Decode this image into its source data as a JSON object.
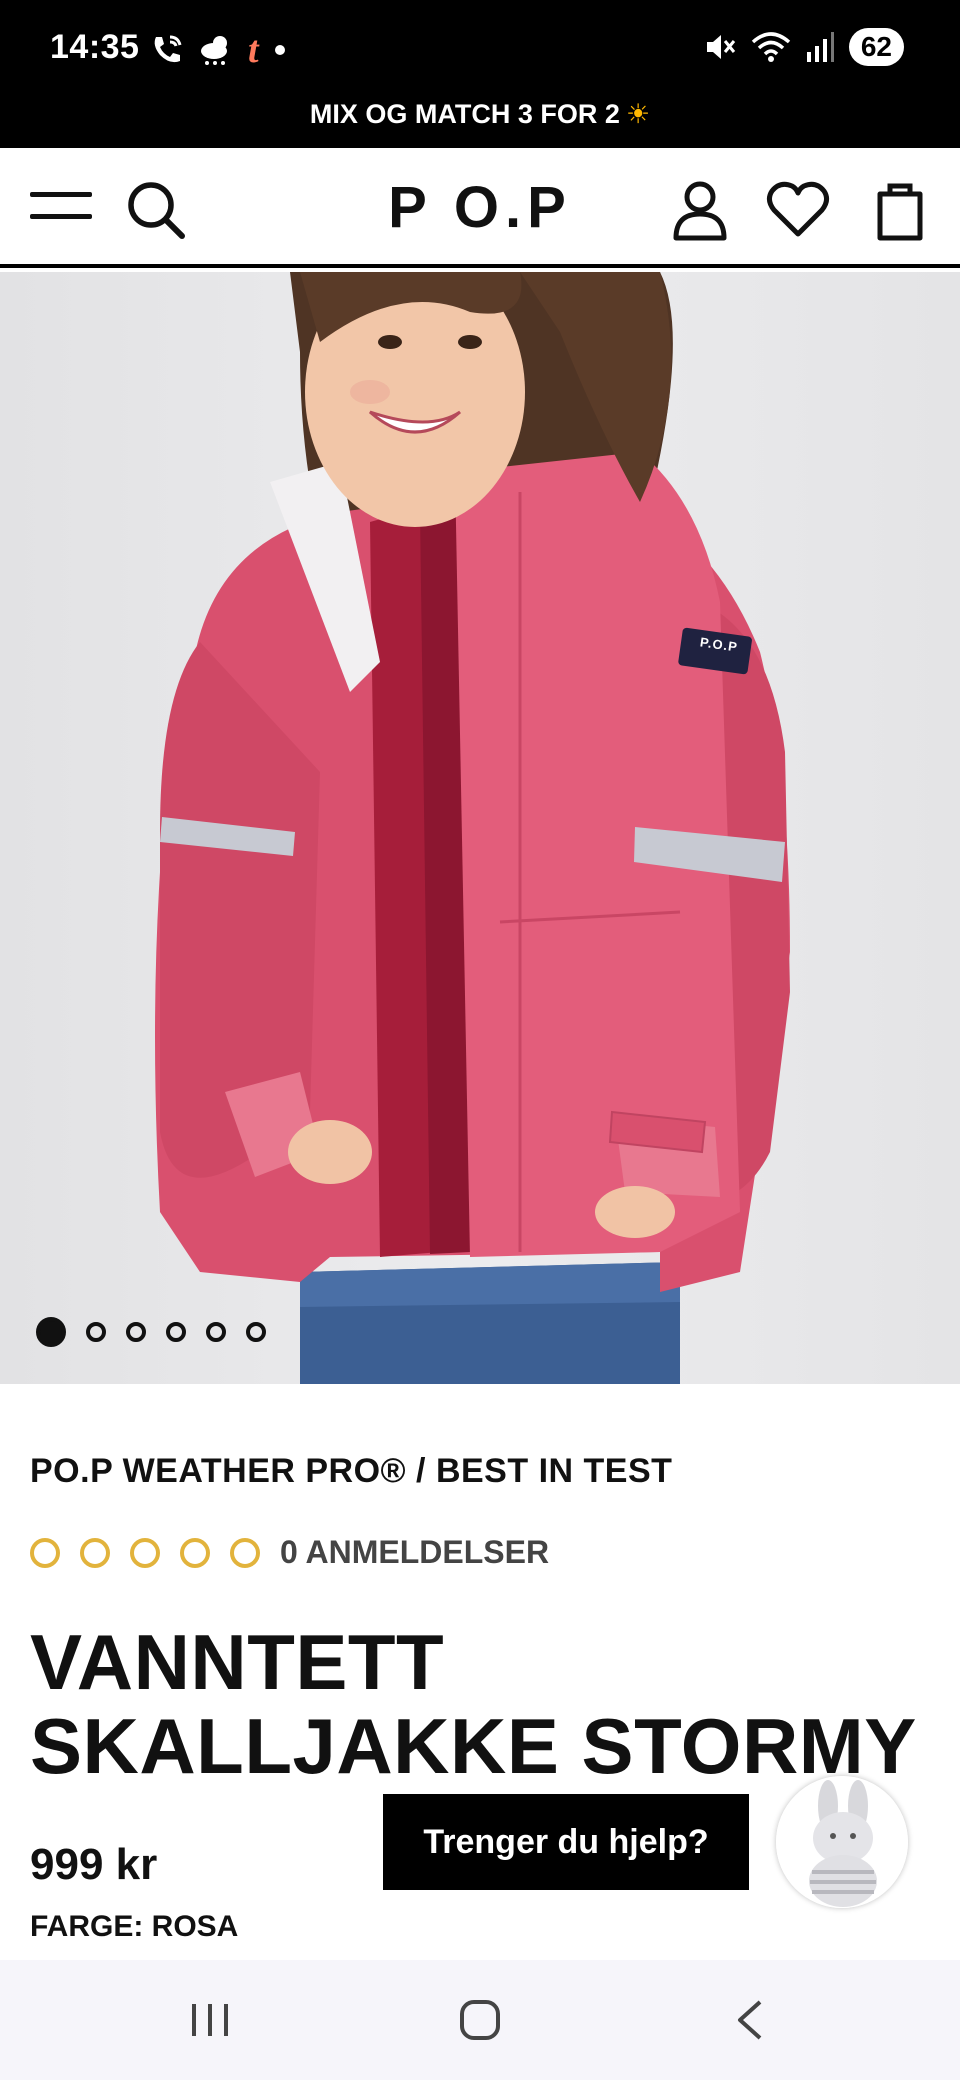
{
  "status_bar": {
    "time": "14:35",
    "battery": "62",
    "icons_left": [
      "phone-wifi-icon",
      "weather-cloud-icon",
      "t-app-icon",
      "dot-icon"
    ],
    "icons_right": [
      "mute-icon",
      "wifi-icon",
      "signal-icon",
      "battery-icon"
    ]
  },
  "promo": {
    "text": "MIX OG MATCH 3 FOR 2",
    "icon": "sun-icon"
  },
  "header": {
    "logo": "P O.P",
    "icons": [
      "menu-icon",
      "search-icon",
      "account-icon",
      "wishlist-icon",
      "cart-icon"
    ]
  },
  "hero": {
    "slide_count": 6,
    "active_slide": 1
  },
  "product": {
    "brand_line": "PO.P WEATHER PRO® / BEST IN TEST",
    "rating": 0,
    "review_count_text": "0 ANMELDELSER",
    "title": "VANNTETT SKALLJAKKE STORMY",
    "price": "999 kr",
    "color_text": "FARGE: ROSA",
    "jacket_badge": "P.O.P"
  },
  "help": {
    "label": "Trenger du hjelp?"
  },
  "colors": {
    "accent_star": "#e2b33c",
    "promo_bg": "#000000",
    "jacket_pink": "#d9506e"
  }
}
